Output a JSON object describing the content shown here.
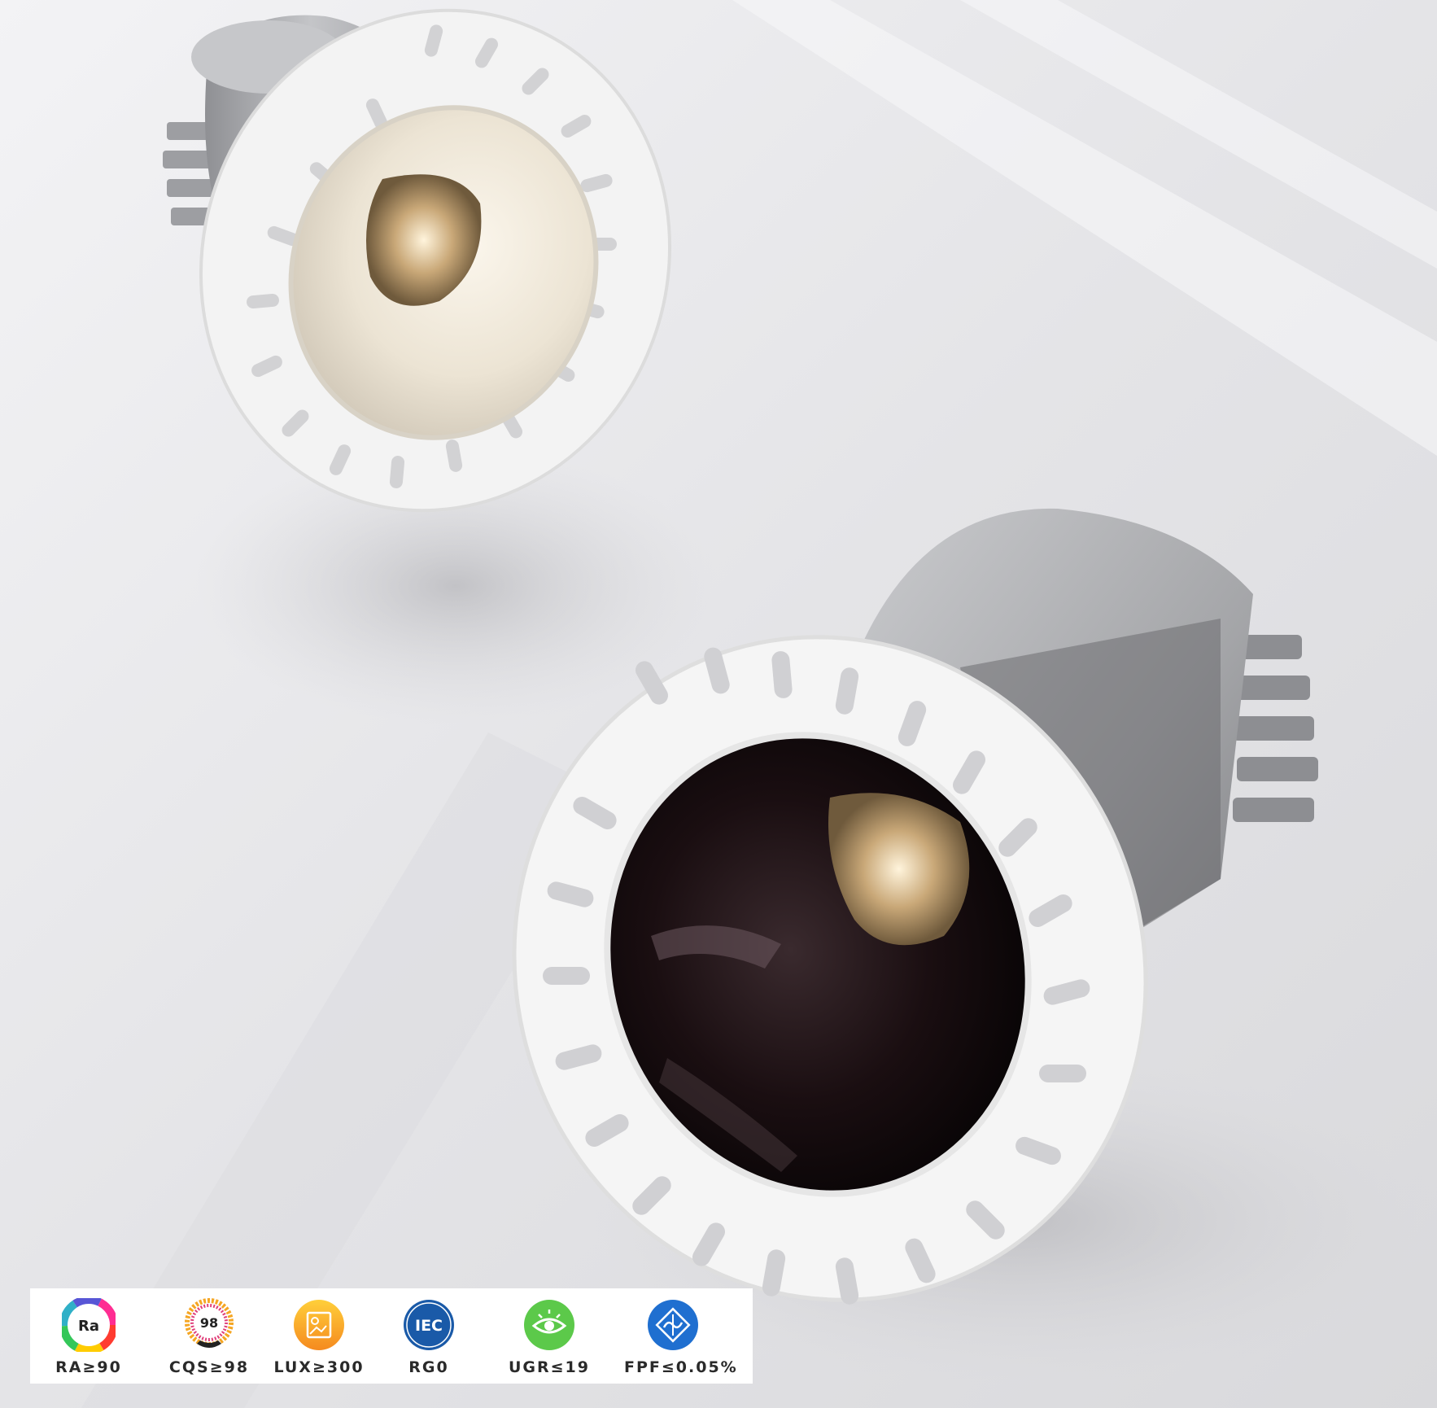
{
  "badges": [
    {
      "id": "ra",
      "icon": "ra-color-wheel-icon",
      "icon_text": "Ra",
      "label": "RA≥90"
    },
    {
      "id": "cqs",
      "icon": "cqs-98-color-icon",
      "icon_text": "98",
      "label": "CQS≥98"
    },
    {
      "id": "lux",
      "icon": "lux-document-icon",
      "icon_text": "",
      "label": "LUX≥300"
    },
    {
      "id": "rg0",
      "icon": "iec-logo-icon",
      "icon_text": "IEC",
      "label": "RG0"
    },
    {
      "id": "ugr",
      "icon": "eye-glare-icon",
      "icon_text": "",
      "label": "UGR≤19"
    },
    {
      "id": "fpf",
      "icon": "flicker-wave-icon",
      "icon_text": "",
      "label": "FPF≤0.05%"
    }
  ],
  "colors": {
    "background": "#e9e9eb",
    "housing_gray": "#a9aaad",
    "trim_white": "#f7f7f7",
    "reflector_black": "#1a1012",
    "light_warm": "#f4ead8",
    "ugr_green": "#5cc94a",
    "iec_blue": "#1a5aa8",
    "fpf_blue": "#1f6fd0",
    "lux_orange": "#f7a531"
  }
}
